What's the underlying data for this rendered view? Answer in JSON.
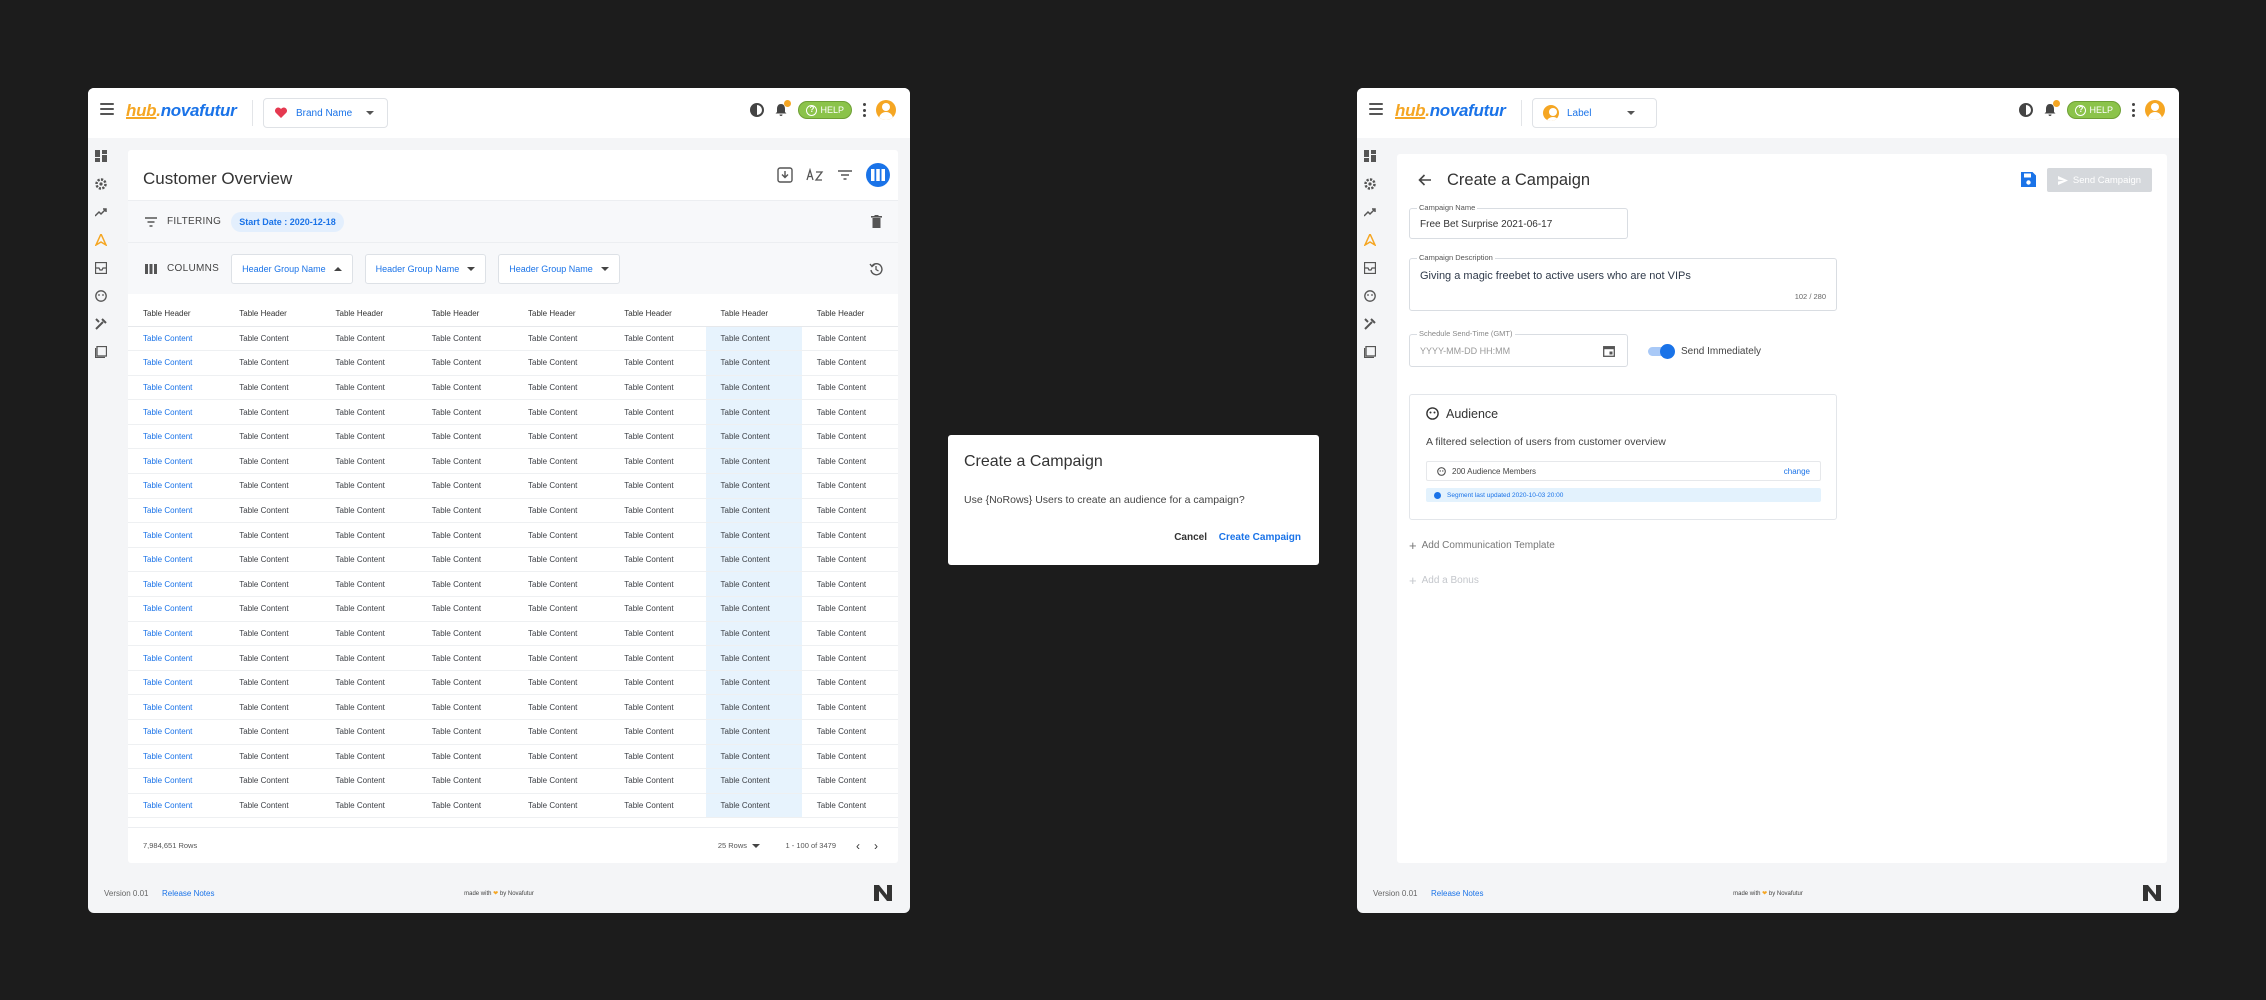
{
  "left_window": {
    "logo": {
      "hub": "hub",
      "dot": ".",
      "name": "novafutur"
    },
    "brand_select": {
      "label": "Brand Name"
    },
    "help_label": "HELP",
    "page_title": "Customer Overview",
    "filtering": {
      "label": "FILTERING",
      "chip": "Start Date : 2020-12-18"
    },
    "columns": {
      "label": "COLUMNS",
      "groups": [
        "Header Group Name",
        "Header Group Name",
        "Header Group Name"
      ]
    },
    "table": {
      "headers": [
        "Table Header",
        "Table Header",
        "Table Header",
        "Table Header",
        "Table Header",
        "Table Header",
        "Table Header",
        "Table Header"
      ],
      "cell_text": "Table Content",
      "row_count_visible": 20
    },
    "pager": {
      "rows_total": "7,984,651 Rows",
      "per_page": "25 Rows",
      "range": "1 - 100 of 3479"
    },
    "footer": {
      "version": "Version 0.01",
      "release_notes": "Release Notes",
      "made_with_pre": "made with",
      "made_with_post": "by Novafutur"
    }
  },
  "dialog": {
    "title": "Create a Campaign",
    "body": "Use {NoRows} Users to create an audience for a campaign?",
    "cancel": "Cancel",
    "confirm": "Create Campaign"
  },
  "right_window": {
    "logo": {
      "hub": "hub",
      "dot": ".",
      "name": "novafutur"
    },
    "label_select": {
      "label": "Label"
    },
    "help_label": "HELP",
    "page_title": "Create a Campaign",
    "send_button": "Send Campaign",
    "campaign_name": {
      "label": "Campaign Name",
      "value": "Free Bet Surprise 2021-06-17"
    },
    "campaign_description": {
      "label": "Campaign Description",
      "value": "Giving a magic freebet to active users who are not VIPs",
      "counter": "102 / 280"
    },
    "schedule": {
      "label": "Schedule Send-Time (GMT)",
      "placeholder": "YYYY-MM-DD HH:MM"
    },
    "send_immediately": {
      "label": "Send Immediately",
      "on": true
    },
    "audience": {
      "title": "Audience",
      "description": "A filtered selection of users from customer overview",
      "members": "200 Audience Members",
      "change": "change",
      "info": "Segment last updated 2020-10-03 20:00"
    },
    "add_template": "Add Communication Template",
    "add_bonus": "Add a Bonus",
    "footer": {
      "version": "Version 0.01",
      "release_notes": "Release Notes",
      "made_with_pre": "made with",
      "made_with_post": "by Novafutur"
    }
  },
  "colors": {
    "accent": "#1a73e8",
    "brand_orange": "#f5a623",
    "help_green": "#8bc34a",
    "highlight_col": "#e7f3fd"
  }
}
